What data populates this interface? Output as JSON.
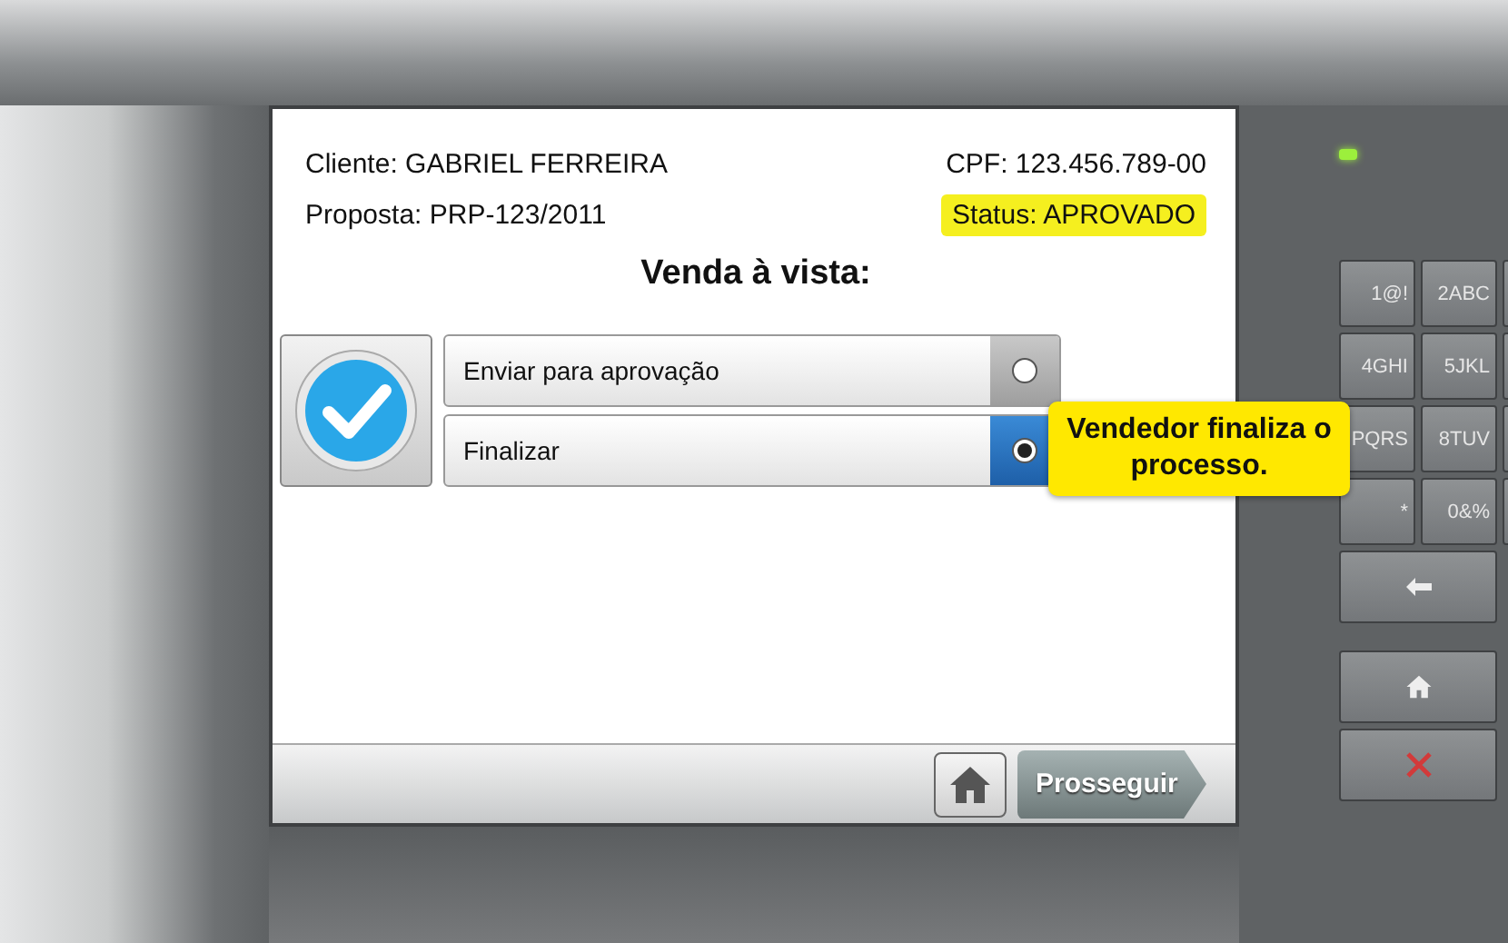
{
  "screen": {
    "client": "Cliente: GABRIEL FERREIRA",
    "cpf": "CPF: 123.456.789-00",
    "proposal": "Proposta: PRP-123/2011",
    "status": "Status: APROVADO",
    "title": "Venda à vista:",
    "options": [
      {
        "label": "Enviar para aprovação",
        "selected": false
      },
      {
        "label": "Finalizar",
        "selected": true
      }
    ],
    "callout": "Vendedor finaliza o processo.",
    "next_button": "Prosseguir"
  },
  "keypad": {
    "keys": [
      "1@!",
      "2ABC",
      "4GHI",
      "5JKL",
      "PQRS",
      "8TUV",
      "*",
      "0&%"
    ]
  }
}
